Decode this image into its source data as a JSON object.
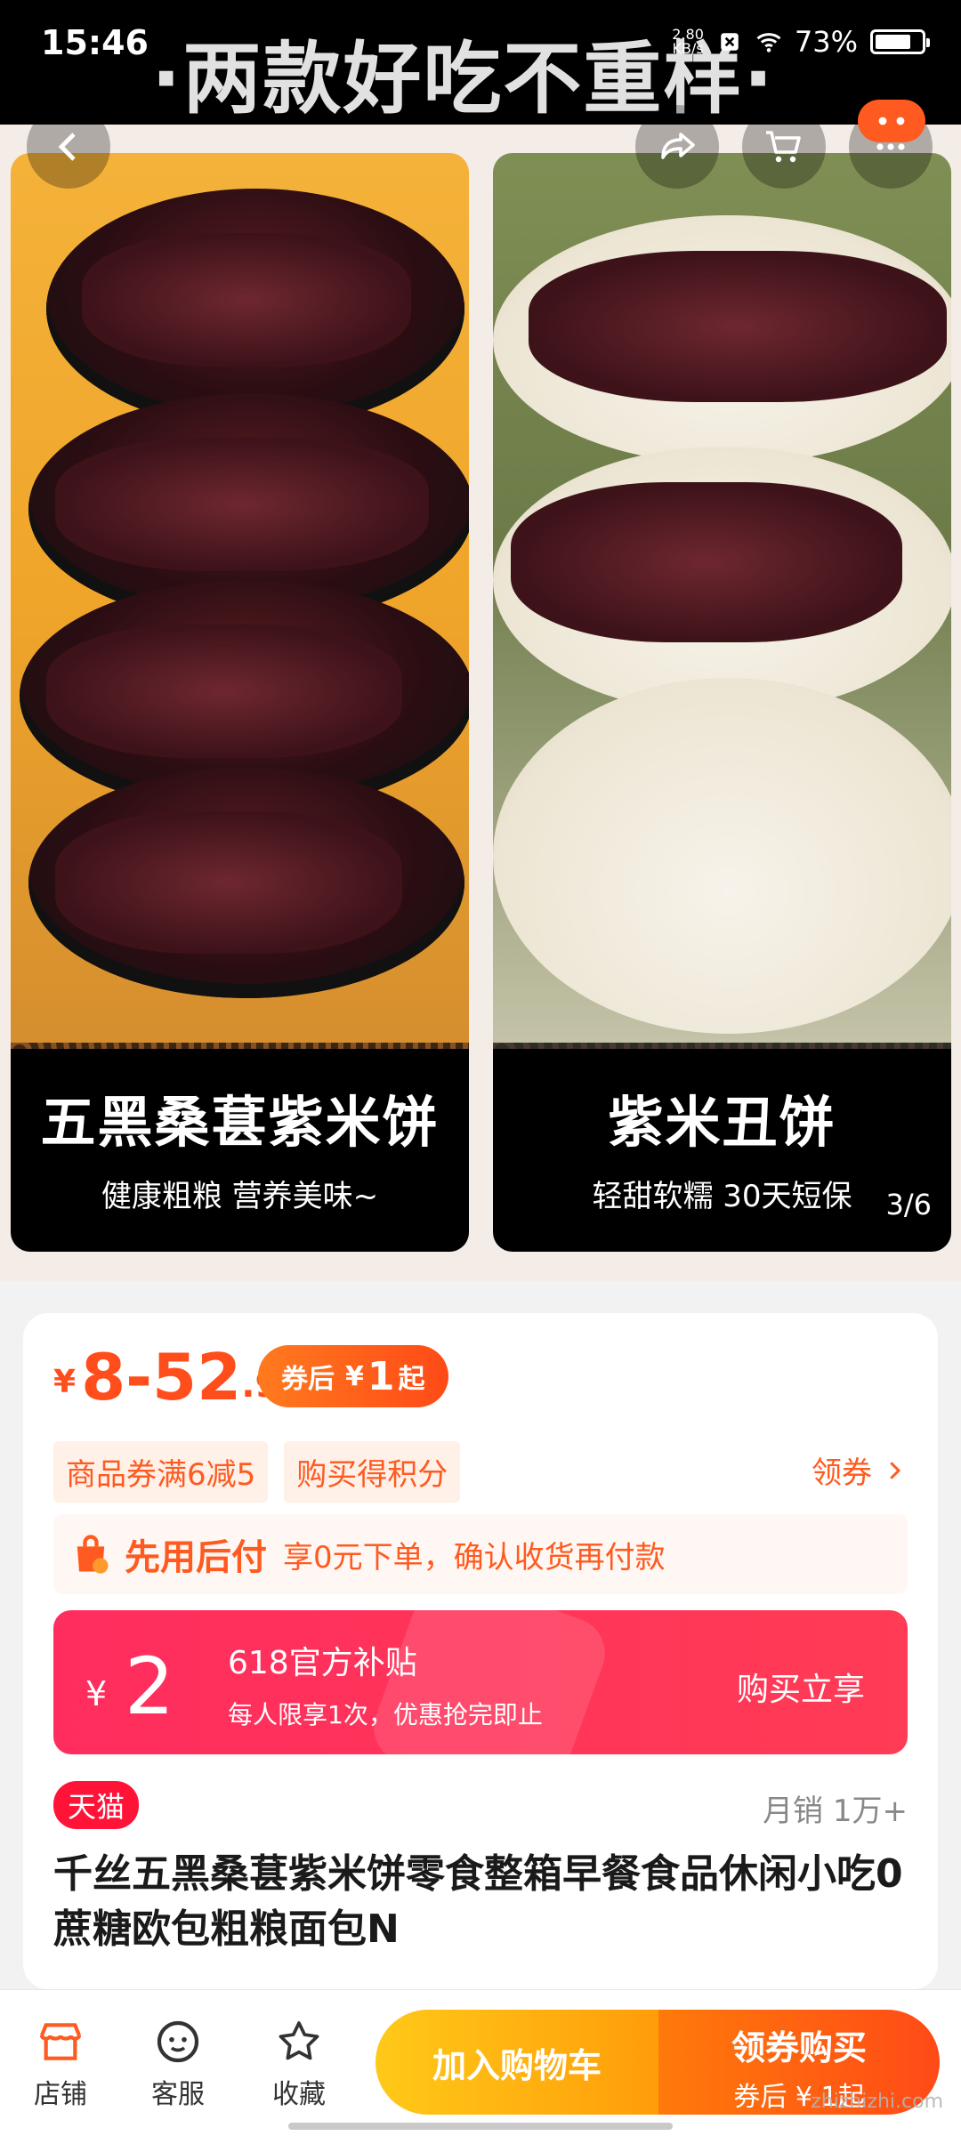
{
  "status_bar": {
    "time": "15:46",
    "net_speed_value": "2.80",
    "net_speed_unit": "KB/s",
    "battery": "73%"
  },
  "banner_text": "·两款好吃不重样·",
  "gallery": {
    "left_caption_title": "五黑桑葚紫米饼",
    "left_caption_sub": "健康粗粮 营养美味~",
    "right_caption_title": "紫米丑饼",
    "right_caption_sub": "轻甜软糯 30天短保",
    "page_indicator": "3/6"
  },
  "price": {
    "symbol": "¥",
    "main": "8-52",
    "decimal": ".9",
    "coupon_prefix": "券后",
    "coupon_symbol": "¥",
    "coupon_amount": "1",
    "coupon_suffix": "起"
  },
  "tags": [
    "商品券满6减5",
    "购买得积分"
  ],
  "get_coupon": "领券",
  "bnpl": {
    "title": "先用后付",
    "desc": "享0元下单，确认收货再付款"
  },
  "subsidy": {
    "symbol": "¥",
    "amount": "2",
    "title": "618官方补贴",
    "desc": "每人限享1次，优惠抢完即止",
    "action": "购买立享"
  },
  "tmall_badge": "天猫",
  "monthly_sales": "月销 1万+",
  "product_title": "千丝五黑桑葚紫米饼零食整箱早餐食品休闲小吃0蔗糖欧包粗粮面包N",
  "bottom_bar": {
    "store": "店铺",
    "service": "客服",
    "favorite": "收藏",
    "add_to_cart": "加入购物车",
    "buy_title": "领券购买",
    "buy_sub": "券后 ¥ 1起"
  },
  "watermark": "zhizhizhi.com",
  "colors": {
    "accent": "#ff4e1c",
    "subsidy": "#ff2d5e",
    "cart": "#ffb012"
  }
}
